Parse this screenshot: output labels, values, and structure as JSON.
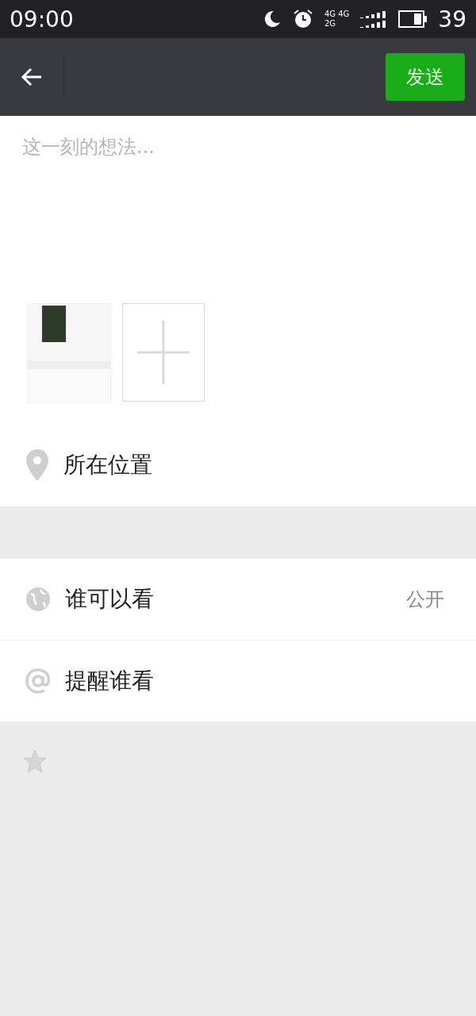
{
  "status_bar": {
    "time": "09:00",
    "network_top": "4G 4G",
    "network_bottom": "2G",
    "battery": "39"
  },
  "header": {
    "send_button": "发送"
  },
  "post": {
    "placeholder": "这一刻的想法...",
    "attachments": [
      {
        "kind": "image"
      },
      {
        "kind": "add"
      }
    ]
  },
  "location": {
    "label": "所在位置"
  },
  "settings": [
    {
      "kind": "visibility",
      "label": "谁可以看",
      "value": "公开"
    },
    {
      "kind": "mention",
      "label": "提醒谁看"
    }
  ]
}
